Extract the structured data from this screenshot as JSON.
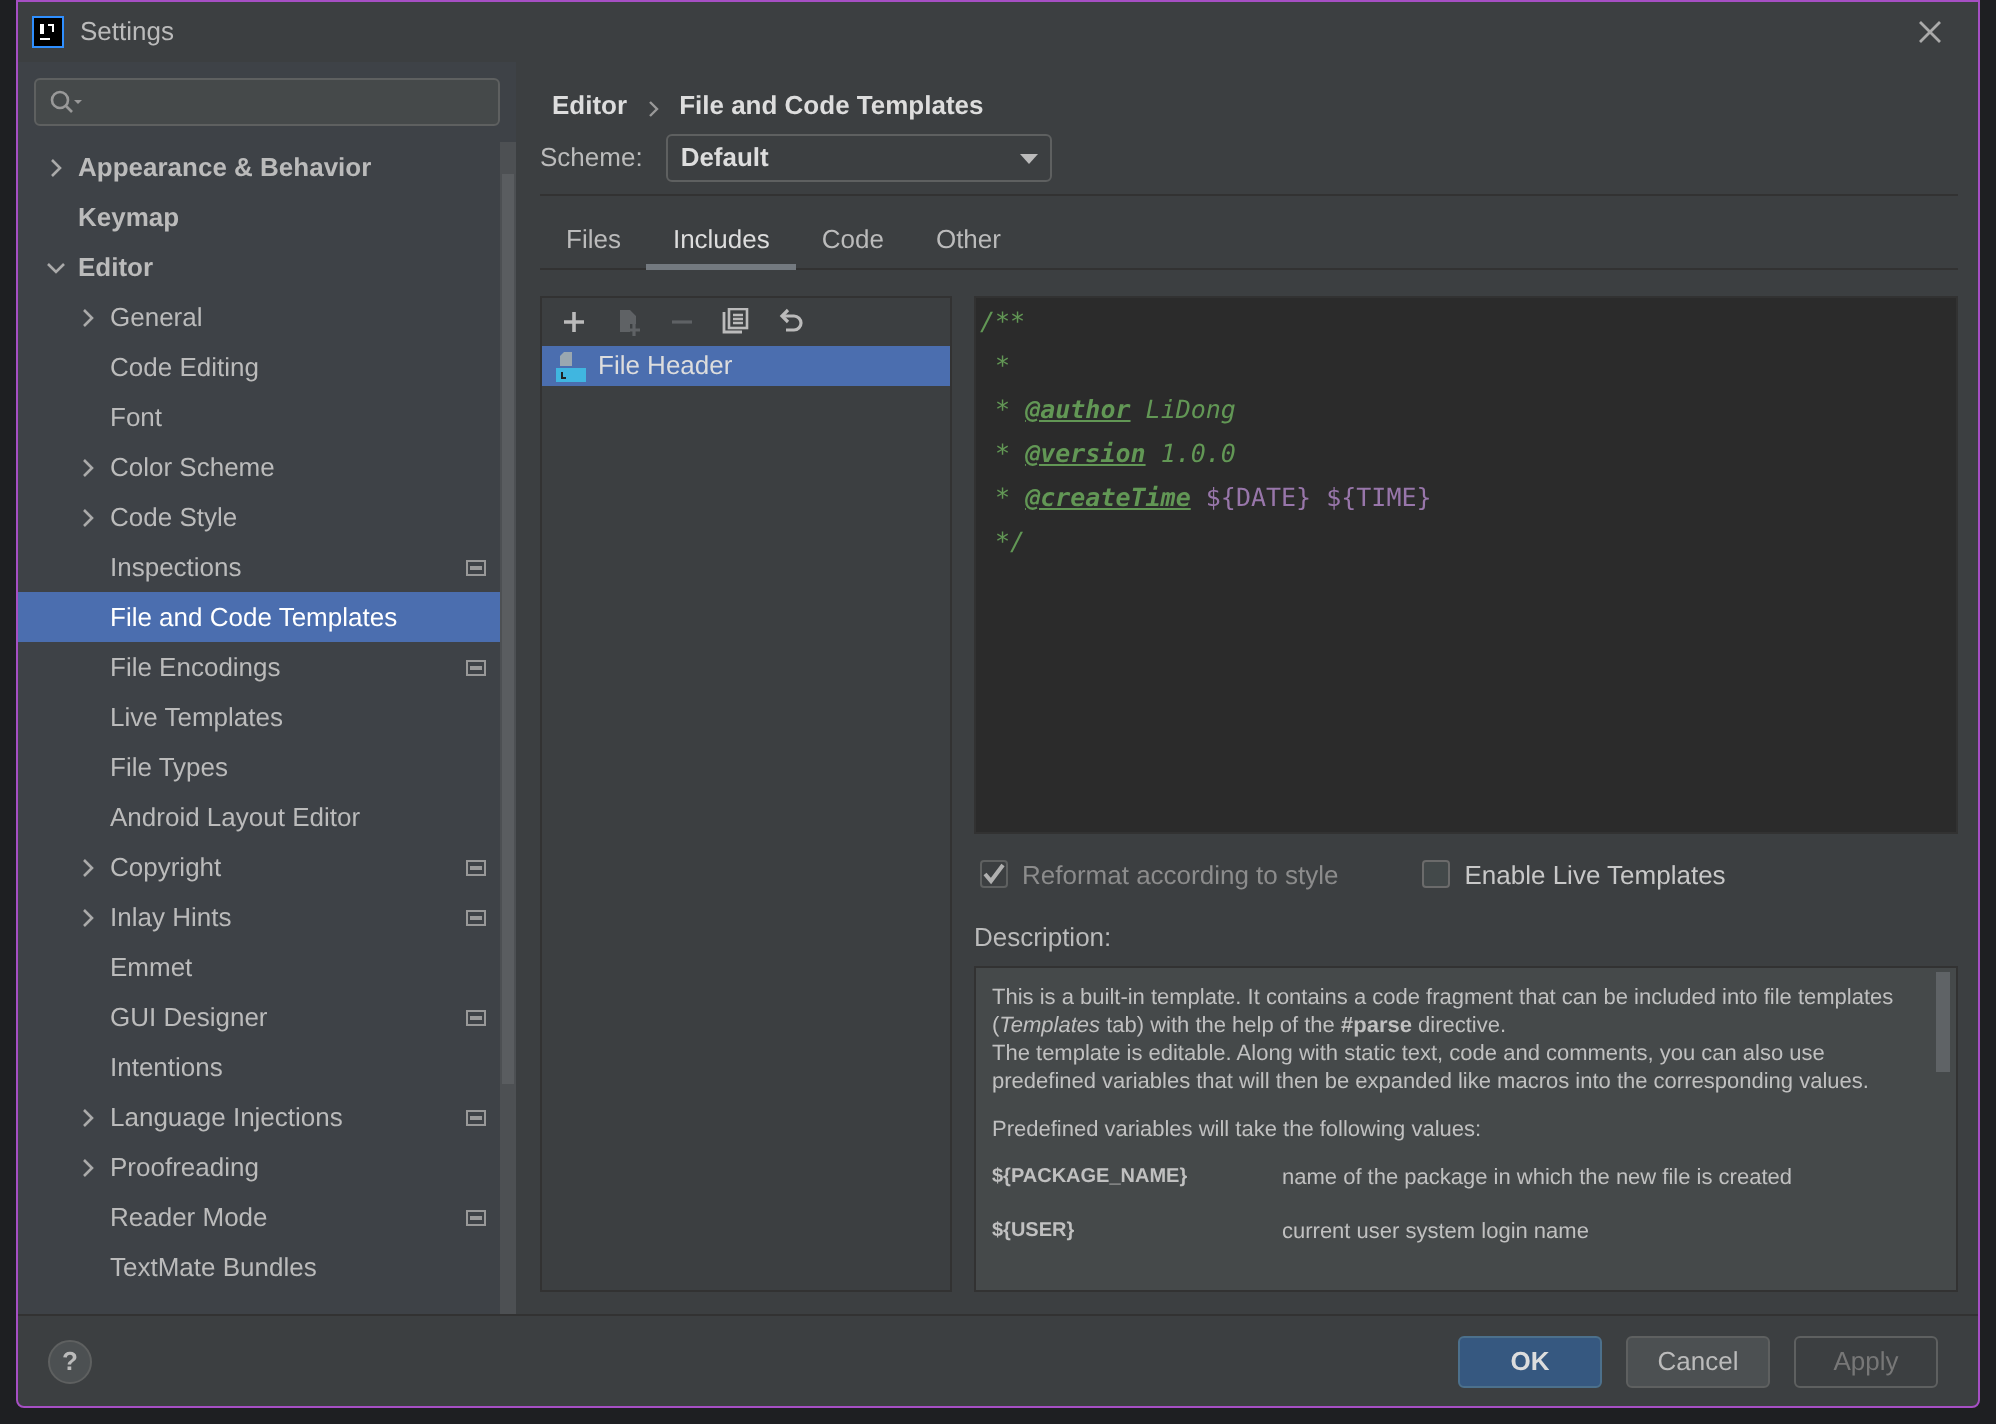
{
  "window": {
    "title": "Settings"
  },
  "sidebar": {
    "items": [
      {
        "label": "Appearance & Behavior",
        "expanded": false,
        "project_level": false,
        "selected": false
      },
      {
        "label": "Keymap",
        "project_level": false,
        "selected": false
      },
      {
        "label": "Editor",
        "expanded": true,
        "project_level": false,
        "selected": false,
        "children": [
          {
            "label": "General",
            "expanded": false,
            "project_level": false,
            "selected": false
          },
          {
            "label": "Code Editing",
            "project_level": false,
            "selected": false
          },
          {
            "label": "Font",
            "project_level": false,
            "selected": false
          },
          {
            "label": "Color Scheme",
            "expanded": false,
            "project_level": false,
            "selected": false
          },
          {
            "label": "Code Style",
            "expanded": false,
            "project_level": false,
            "selected": false
          },
          {
            "label": "Inspections",
            "project_level": true,
            "selected": false
          },
          {
            "label": "File and Code Templates",
            "project_level": false,
            "selected": true
          },
          {
            "label": "File Encodings",
            "project_level": true,
            "selected": false
          },
          {
            "label": "Live Templates",
            "project_level": false,
            "selected": false
          },
          {
            "label": "File Types",
            "project_level": false,
            "selected": false
          },
          {
            "label": "Android Layout Editor",
            "project_level": false,
            "selected": false
          },
          {
            "label": "Copyright",
            "expanded": false,
            "project_level": true,
            "selected": false
          },
          {
            "label": "Inlay Hints",
            "expanded": false,
            "project_level": true,
            "selected": false
          },
          {
            "label": "Emmet",
            "project_level": false,
            "selected": false
          },
          {
            "label": "GUI Designer",
            "project_level": true,
            "selected": false
          },
          {
            "label": "Intentions",
            "project_level": false,
            "selected": false
          },
          {
            "label": "Language Injections",
            "expanded": false,
            "project_level": true,
            "selected": false
          },
          {
            "label": "Proofreading",
            "expanded": false,
            "project_level": false,
            "selected": false
          },
          {
            "label": "Reader Mode",
            "project_level": true,
            "selected": false
          },
          {
            "label": "TextMate Bundles",
            "project_level": false,
            "selected": false
          }
        ]
      }
    ]
  },
  "breadcrumb": [
    "Editor",
    "File and Code Templates"
  ],
  "scheme": {
    "label": "Scheme:",
    "value": "Default"
  },
  "tabs": [
    {
      "label": "Files",
      "selected": false
    },
    {
      "label": "Includes",
      "selected": true
    },
    {
      "label": "Code",
      "selected": false
    },
    {
      "label": "Other",
      "selected": false
    }
  ],
  "toolbar": [
    {
      "kind": "add",
      "disabled": false
    },
    {
      "kind": "add-child",
      "disabled": true
    },
    {
      "kind": "remove",
      "disabled": true
    },
    {
      "kind": "copy",
      "disabled": false
    },
    {
      "kind": "reset",
      "disabled": false
    }
  ],
  "templates": [
    {
      "label": "File Header",
      "selected": true
    }
  ],
  "code": [
    [
      {
        "kind": "comment",
        "text": "/**"
      }
    ],
    [
      {
        "kind": "comment",
        "text": " *"
      }
    ],
    [
      {
        "kind": "comment",
        "text": " * "
      },
      {
        "kind": "tag",
        "text": "@author"
      },
      {
        "kind": "comment",
        "text": " LiDong"
      }
    ],
    [
      {
        "kind": "comment",
        "text": " * "
      },
      {
        "kind": "tag",
        "text": "@version"
      },
      {
        "kind": "comment",
        "text": " 1.0.0"
      }
    ],
    [
      {
        "kind": "comment",
        "text": " * "
      },
      {
        "kind": "tag",
        "text": "@createTime"
      },
      {
        "kind": "variable",
        "text": "${DATE}"
      },
      {
        "kind": "variable",
        "text": "${TIME}"
      }
    ],
    [
      {
        "kind": "comment",
        "text": " */"
      }
    ]
  ],
  "options": [
    {
      "label": "Reformat according to style",
      "checked": true,
      "disabled": true
    },
    {
      "label": "Enable Live Templates",
      "checked": false,
      "disabled": false
    }
  ],
  "description": {
    "label": "Description:",
    "paragraphs": [
      "This is a built-in template. It contains a code fragment that can be included into file templates (*Templates* tab) with the help of the **#parse** directive.\nThe template is editable. Along with static text, code and comments, you can also use predefined variables that will then be expanded like macros into the corresponding values.",
      "Predefined variables will take the following values:"
    ],
    "variables": [
      {
        "name": "${PACKAGE_NAME}",
        "meaning": "name of the package in which the new file is created"
      },
      {
        "name": "${USER}",
        "meaning": "current user system login name"
      }
    ]
  },
  "help": {
    "label": "?"
  },
  "buttons": [
    {
      "label": "OK",
      "kind": "primary",
      "disabled": false
    },
    {
      "label": "Cancel",
      "kind": "normal",
      "disabled": false
    },
    {
      "label": "Apply",
      "kind": "normal",
      "disabled": true
    }
  ]
}
